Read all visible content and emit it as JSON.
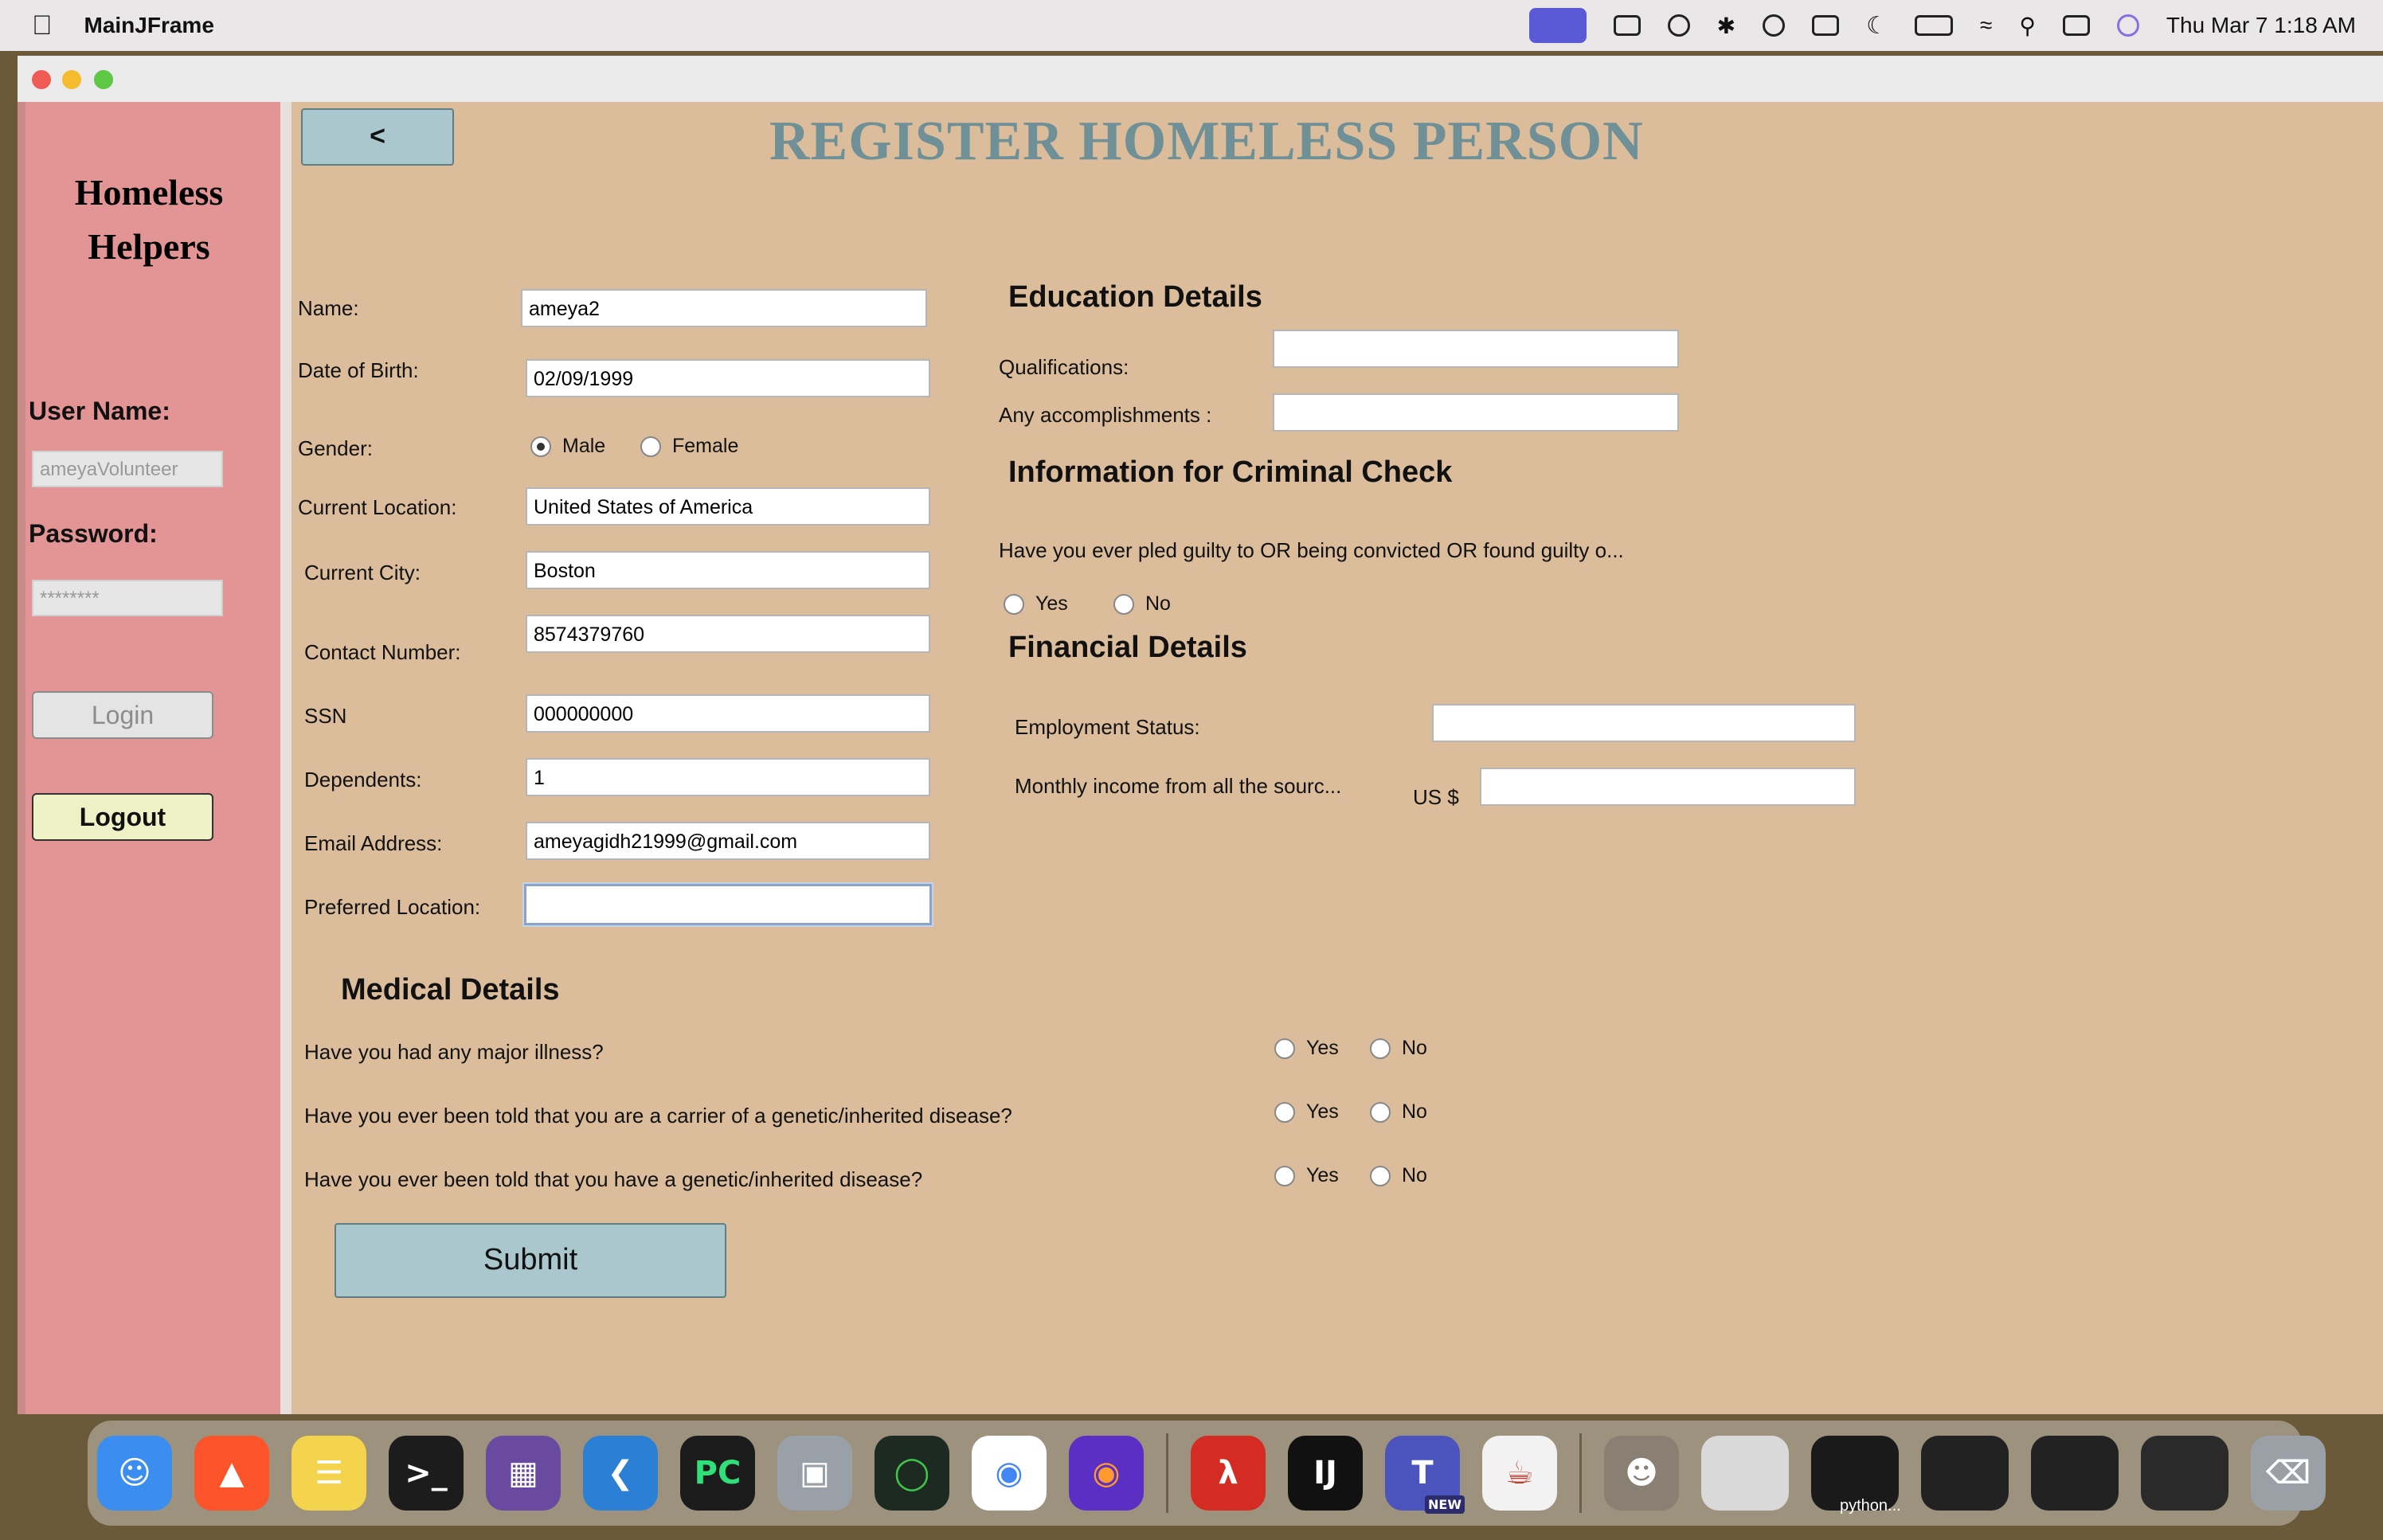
{
  "menubar": {
    "app_name": "MainJFrame",
    "clock": "Thu Mar 7  1:18 AM"
  },
  "sidebar": {
    "brand_line1": "Homeless",
    "brand_line2": "Helpers",
    "username_label": "User Name:",
    "username_value": "ameyaVolunteer",
    "password_label": "Password:",
    "password_value": "********",
    "login_label": "Login",
    "logout_label": "Logout"
  },
  "header": {
    "back_label": "<",
    "title": "REGISTER HOMELESS PERSON"
  },
  "personal": {
    "name_label": "Name:",
    "name_value": "ameya2",
    "dob_label": "Date of Birth:",
    "dob_value": "02/09/1999",
    "gender_label": "Gender:",
    "gender_male": "Male",
    "gender_female": "Female",
    "location_label": "Current Location:",
    "location_value": "United States of America",
    "city_label": "Current City:",
    "city_value": "Boston",
    "contact_label": "Contact Number:",
    "contact_value": "8574379760",
    "ssn_label": "SSN",
    "ssn_value": "000000000",
    "dependents_label": "Dependents:",
    "dependents_value": "1",
    "email_label": "Email Address:",
    "email_value": "ameyagidh21999@gmail.com",
    "preferred_label": "Preferred Location:",
    "preferred_value": ""
  },
  "education": {
    "heading": "Education Details",
    "qualifications_label": "Qualifications:",
    "accomplishments_label": "Any accomplishments :"
  },
  "criminal": {
    "heading": "Information for Criminal Check",
    "question": "Have you ever pled guilty to OR being convicted OR found guilty o...",
    "yes": "Yes",
    "no": "No"
  },
  "financial": {
    "heading": "Financial Details",
    "employment_label": "Employment Status:",
    "income_label": "Monthly income from all the sourc...",
    "currency_label": "US $"
  },
  "medical": {
    "heading": "Medical Details",
    "q1": "Have you had any major illness?",
    "q2": "Have you ever been told that you are a carrier of a genetic/inherited disease?",
    "q3": "Have you ever been told that you have a genetic/inherited disease?",
    "yes": "Yes",
    "no": "No"
  },
  "submit_label": "Submit",
  "dock": {
    "pycharm": "PC",
    "intellij": "IJ",
    "teams_badge": "NEW",
    "python_label": "python..."
  }
}
